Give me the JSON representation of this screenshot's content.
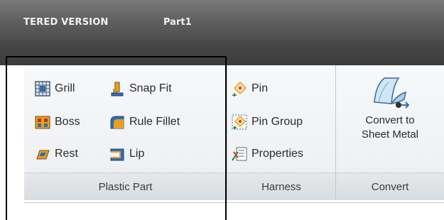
{
  "titlebar": {
    "app_label": "TERED VERSION",
    "doc_title": "Part1"
  },
  "panels": {
    "plastic": {
      "title": "Plastic Part",
      "items": [
        {
          "label": "Grill",
          "icon": "grill-icon"
        },
        {
          "label": "Snap Fit",
          "icon": "snap-fit-icon"
        },
        {
          "label": "Boss",
          "icon": "boss-icon"
        },
        {
          "label": "Rule Fillet",
          "icon": "rule-fillet-icon"
        },
        {
          "label": "Rest",
          "icon": "rest-icon"
        },
        {
          "label": "Lip",
          "icon": "lip-icon"
        }
      ]
    },
    "harness": {
      "title": "Harness",
      "items": [
        {
          "label": "Pin",
          "icon": "pin-icon"
        },
        {
          "label": "Pin Group",
          "icon": "pin-group-icon"
        },
        {
          "label": "Properties",
          "icon": "properties-icon"
        }
      ]
    },
    "convert": {
      "title": "Convert",
      "button": {
        "line1": "Convert to",
        "line2": "Sheet Metal",
        "icon": "convert-sheet-metal-icon"
      }
    }
  },
  "colors": {
    "accent_orange": "#e8a020",
    "accent_blue": "#2f6db5",
    "ribbon_bg": "#f1f2f4"
  }
}
